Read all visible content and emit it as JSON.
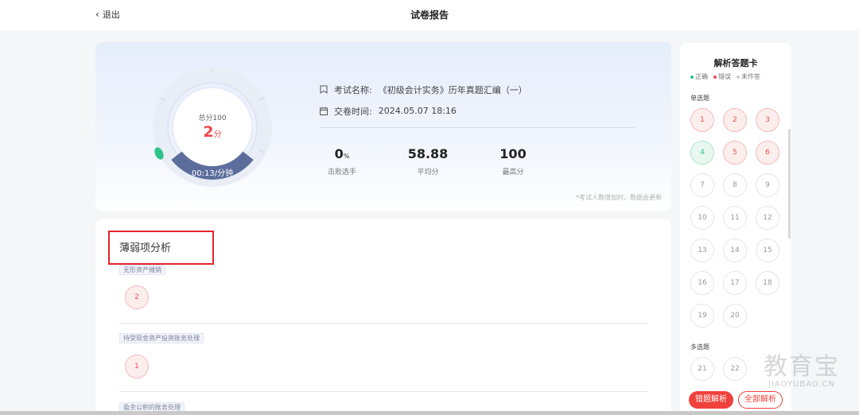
{
  "header": {
    "back_label": "退出",
    "title": "试卷报告"
  },
  "summary": {
    "total_label": "总分100",
    "score_value": "2",
    "score_unit": "分",
    "speed": "00:13/分钟",
    "exam_name_label": "考试名称:",
    "exam_name": "《初级会计实务》历年真题汇编（一）",
    "submit_time_label": "交卷时间:",
    "submit_time": "2024.05.07 18:16",
    "stats": [
      {
        "value": "0",
        "unit": "%",
        "label": "击败选手"
      },
      {
        "value": "58.88",
        "unit": "",
        "label": "平均分"
      },
      {
        "value": "100",
        "unit": "",
        "label": "最高分"
      }
    ],
    "notice": "*考试人数增加时，数据会更新",
    "colors": {
      "score": "#ef4b4b",
      "gauge_ring": "#e9edf6",
      "gauge_band": "#5c6d9c",
      "gauge_marker": "#2ec489"
    }
  },
  "weak": {
    "title": "薄弱项分析",
    "items": [
      {
        "tag": "无形资产摊销",
        "question": "2"
      },
      {
        "tag": "持受现金资产投资账务处理",
        "question": "1"
      },
      {
        "tag": "盈余公积的账务处理",
        "question": ""
      }
    ]
  },
  "answer_card": {
    "title": "解析答题卡",
    "legend": [
      {
        "label": "正确",
        "color": "#2ec489"
      },
      {
        "label": "错误",
        "color": "#ef4b4b"
      },
      {
        "label": "未作答",
        "color": "#cccccc"
      }
    ],
    "single_label": "单选题",
    "single": [
      "1",
      "2",
      "3",
      "4",
      "5",
      "6",
      "7",
      "8",
      "9",
      "10",
      "11",
      "12",
      "13",
      "14",
      "15",
      "16",
      "17",
      "18",
      "19",
      "20"
    ],
    "single_status": [
      "wrong",
      "wrong",
      "wrong",
      "right",
      "wrong",
      "wrong",
      "none",
      "none",
      "none",
      "none",
      "none",
      "none",
      "none",
      "none",
      "none",
      "none",
      "none",
      "none",
      "none",
      "none"
    ],
    "multi_label": "多选题",
    "multi": [
      "21",
      "22"
    ],
    "wrong_analysis_button": "错题解析",
    "all_analysis_button": "全部解析"
  },
  "watermark": {
    "cn": "教育宝",
    "en": "JIAOYUBAO.CN"
  }
}
